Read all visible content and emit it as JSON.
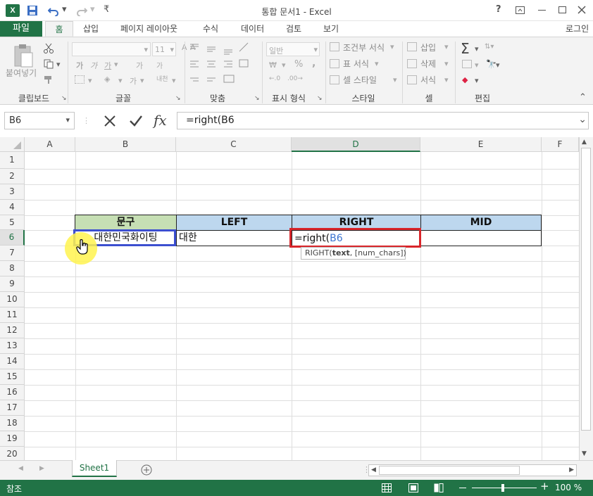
{
  "app": {
    "logo": "X",
    "title": "통합 문서1 - Excel",
    "help": "?",
    "login": "로그인"
  },
  "ribbon_tabs": [
    "파일",
    "홈",
    "삽입",
    "페이지 레이아웃",
    "수식",
    "데이터",
    "검토",
    "보기"
  ],
  "ribbon": {
    "clipboard": {
      "paste": "붙여넣기",
      "label": "클립보드"
    },
    "font": {
      "size": "11",
      "label": "글꼴",
      "bold": "가",
      "italic": "가",
      "underline": "가",
      "grow": "가",
      "shrink": "가",
      "phonetic": "내천"
    },
    "align": {
      "label": "맞춤"
    },
    "number": {
      "format": "일반",
      "percent": "%",
      "comma": ",",
      "label": "표시 형식"
    },
    "styles": {
      "conditional": "조건부 서식",
      "table": "표 서식",
      "cell": "셀 스타일",
      "label": "스타일"
    },
    "cells": {
      "insert": "삽입",
      "delete": "삭제",
      "format": "서식",
      "label": "셀"
    },
    "editing": {
      "label": "편집"
    }
  },
  "formula_bar": {
    "name_box": "B6",
    "fx": "fx",
    "formula": "=right(B6"
  },
  "columns": [
    "A",
    "B",
    "C",
    "D",
    "E",
    "F"
  ],
  "rows": [
    "1",
    "2",
    "3",
    "4",
    "5",
    "6",
    "7",
    "8",
    "9",
    "10",
    "11",
    "12",
    "13",
    "14",
    "15",
    "16",
    "17",
    "18",
    "19",
    "20"
  ],
  "table": {
    "h_b": "문구",
    "h_c": "LEFT",
    "h_d": "RIGHT",
    "h_e": "MID",
    "b6": "대한민국화이팅",
    "c6": "대한",
    "d6_prefix": "=right(",
    "d6_ref": "B6"
  },
  "tooltip": {
    "fn": "RIGHT(",
    "arg1": "text",
    ", ": ", ",
    "arg2": "[num_chars])"
  },
  "sheet": {
    "name": "Sheet1"
  },
  "status": {
    "mode": "참조",
    "zoom": "100 %"
  },
  "colors": {
    "excel_green": "#217346",
    "header_green": "#c6dfb4",
    "header_blue": "#bdd7ee",
    "highlight_red": "#d9262b",
    "ref_blue": "#3c4fd0",
    "cursor_yellow": "#fff34f"
  }
}
